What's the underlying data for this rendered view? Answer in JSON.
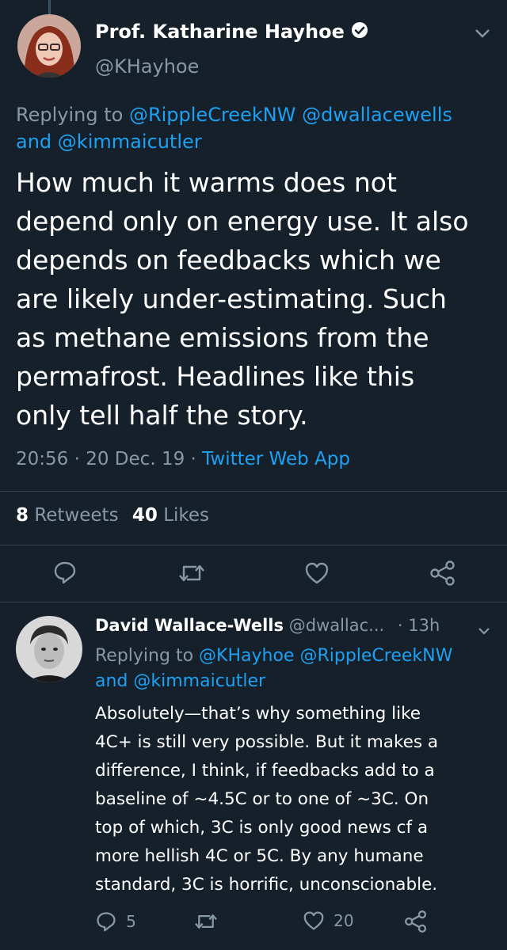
{
  "main_tweet": {
    "display_name": "Prof. Katharine Hayhoe",
    "handle": "@KHayhoe",
    "replying_prefix": "Replying to",
    "replying_to": [
      "@RippleCreekNW",
      "@dwallacewells"
    ],
    "replying_and": "and",
    "replying_last": "@kimmaicutler",
    "body_lines": [
      "How much it warms does not",
      "depend only on energy use. It also",
      "depends on feedbacks which we",
      "are likely under-estimating. Such",
      "as methane emissions from the",
      "permafrost. Headlines like this",
      "only tell half the story."
    ],
    "time": "20:56",
    "date": "20 Dec. 19",
    "source": "Twitter Web App",
    "retweets_count": "8",
    "retweets_label": "Retweets",
    "likes_count": "40",
    "likes_label": "Likes"
  },
  "reply_tweet": {
    "display_name": "David Wallace-Wells",
    "handle": "@dwallac...",
    "age": "13h",
    "replying_prefix": "Replying to",
    "replying_to": [
      "@KHayhoe",
      "@RippleCreekNW"
    ],
    "replying_and": "and",
    "replying_last": "@kimmaicutler",
    "body_lines": [
      "Absolutely—that’s why something like",
      "4C+ is still very possible. But it makes a",
      "difference, I think, if feedbacks add to a",
      "baseline of ~4.5C or to one of ~3C. On",
      "top of which, 3C is only good news cf a",
      "more hellish 4C or 5C. By any humane",
      "standard, 3C is horrific, unconscionable."
    ],
    "reply_count": "5",
    "like_count": "20"
  },
  "icons": {
    "verified": "verified-badge-icon",
    "chevron": "chevron-down-icon",
    "reply": "reply-icon",
    "retweet": "retweet-icon",
    "like": "heart-icon",
    "share": "share-icon"
  },
  "colors": {
    "background": "#15202b",
    "text": "#ffffff",
    "muted": "#8899a6",
    "link": "#1da1f2",
    "divider": "#38444d"
  }
}
